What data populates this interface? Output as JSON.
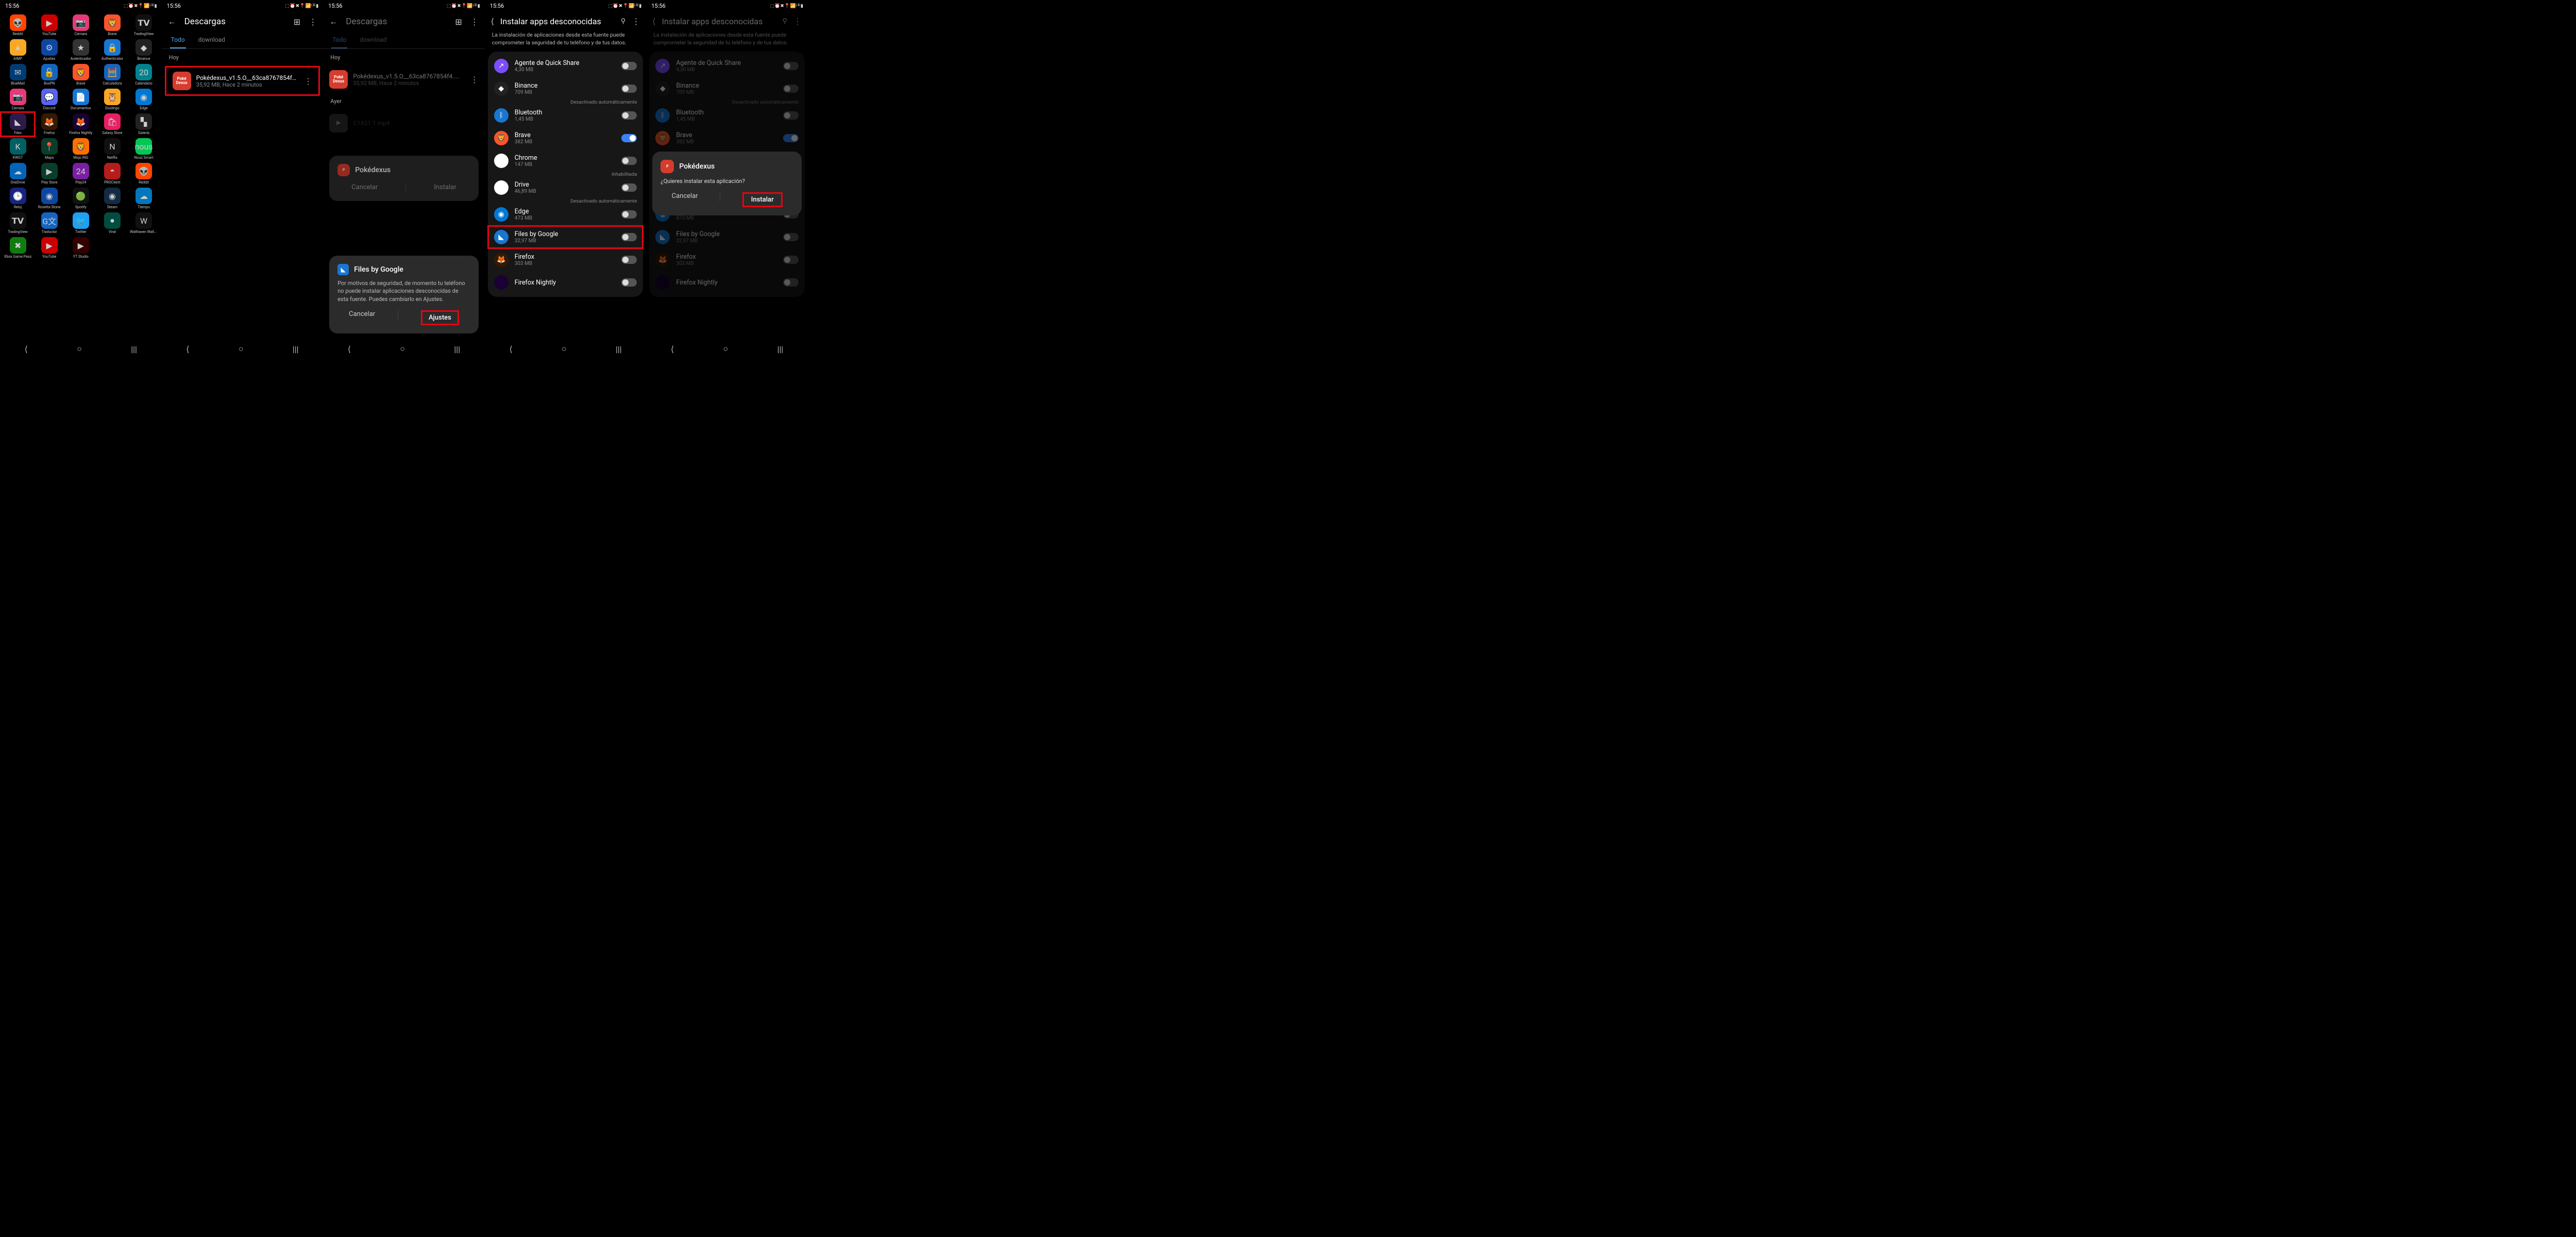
{
  "status": {
    "time": "15:56",
    "icons": "⬚ ⏰ ✖ 📍 📶 ᴸᵀᴱ ▮"
  },
  "nav": {
    "back": "⟨",
    "home": "○",
    "recent": "|||"
  },
  "screen1": {
    "apps": [
      {
        "label": "Reddit",
        "bg": "#ff4500",
        "g": "👽"
      },
      {
        "label": "YouTube",
        "bg": "#cc0000",
        "g": "▶"
      },
      {
        "label": "Cámara",
        "bg": "#e6397a",
        "g": "📷"
      },
      {
        "label": "Brave",
        "bg": "#fb542b",
        "g": "🦁"
      },
      {
        "label": "TradingView",
        "bg": "#111",
        "g": "𝗧𝗩"
      },
      {
        "label": "AIMP",
        "bg": "#f9a825",
        "g": "▲"
      },
      {
        "label": "Ajustes",
        "bg": "#0d47a1",
        "g": "⚙"
      },
      {
        "label": "Autenticador",
        "bg": "#333",
        "g": "★"
      },
      {
        "label": "Authenticator",
        "bg": "#1976d2",
        "g": "🔒"
      },
      {
        "label": "Binance",
        "bg": "#222",
        "g": "◆"
      },
      {
        "label": "BlueMail",
        "bg": "#003b73",
        "g": "✉"
      },
      {
        "label": "BoxPN",
        "bg": "#1565c0",
        "g": "🔓"
      },
      {
        "label": "Brave",
        "bg": "#fb542b",
        "g": "🦁"
      },
      {
        "label": "Calculadora",
        "bg": "#1565c0",
        "g": "🧮"
      },
      {
        "label": "Calendario",
        "bg": "#00838f",
        "g": "20"
      },
      {
        "label": "Cámara",
        "bg": "#e6397a",
        "g": "📷"
      },
      {
        "label": "Discord",
        "bg": "#5865f2",
        "g": "💬"
      },
      {
        "label": "Documentos",
        "bg": "#1976d2",
        "g": "📄"
      },
      {
        "label": "Duolingo",
        "bg": "#f9a825",
        "g": "🦉"
      },
      {
        "label": "Edge",
        "bg": "#0078d4",
        "g": "◉"
      },
      {
        "label": "Files",
        "bg": "#2b1a4a",
        "g": "◣",
        "hl": true
      },
      {
        "label": "Firefox",
        "bg": "#331a00",
        "g": "🦊"
      },
      {
        "label": "Firefox Nightly",
        "bg": "#1a0033",
        "g": "🦊"
      },
      {
        "label": "Galaxy Store",
        "bg": "#e91e63",
        "g": "🛍"
      },
      {
        "label": "Galería",
        "bg": "#222",
        "g": "▚"
      },
      {
        "label": "KWGT",
        "bg": "#006064",
        "g": "K"
      },
      {
        "label": "Maps",
        "bg": "#0a3d2a",
        "g": "📍"
      },
      {
        "label": "Mojo ING",
        "bg": "#ff6f00",
        "g": "🦁"
      },
      {
        "label": "Netflix",
        "bg": "#111",
        "g": "N"
      },
      {
        "label": "Nous Smart",
        "bg": "#00c853",
        "g": "nous"
      },
      {
        "label": "OneDrive",
        "bg": "#0364b8",
        "g": "☁"
      },
      {
        "label": "Play Store",
        "bg": "#0a3d2a",
        "g": "▶"
      },
      {
        "label": "Play24",
        "bg": "#7b1fa2",
        "g": "24"
      },
      {
        "label": "PROClient",
        "bg": "#b71c1c",
        "g": "◓"
      },
      {
        "label": "Reddit",
        "bg": "#ff4500",
        "g": "👽"
      },
      {
        "label": "Reloj",
        "bg": "#1a237e",
        "g": "🕒"
      },
      {
        "label": "Rosetta Stone",
        "bg": "#0d47a1",
        "g": "◉"
      },
      {
        "label": "Spotify",
        "bg": "#111",
        "g": "🟢"
      },
      {
        "label": "Steam",
        "bg": "#132b44",
        "g": "◉"
      },
      {
        "label": "Tiempo",
        "bg": "#0277bd",
        "g": "☁"
      },
      {
        "label": "TradingView",
        "bg": "#111",
        "g": "𝗧𝗩"
      },
      {
        "label": "Traductor",
        "bg": "#1565c0",
        "g": "G文"
      },
      {
        "label": "Twitter",
        "bg": "#1da1f2",
        "g": "🐦"
      },
      {
        "label": "Viral",
        "bg": "#004d40",
        "g": "●"
      },
      {
        "label": "Wallhaven Wallp…",
        "bg": "#111",
        "g": "W"
      },
      {
        "label": "Xbox Game Pass",
        "bg": "#107c10",
        "g": "✖"
      },
      {
        "label": "YouTube",
        "bg": "#cc0000",
        "g": "▶"
      },
      {
        "label": "YT Studio",
        "bg": "#330000",
        "g": "▶"
      }
    ]
  },
  "screen2": {
    "title": "Descargas",
    "tabs": {
      "all": "Todo",
      "download": "download"
    },
    "today": "Hoy",
    "file": {
      "name": "Pokédexus_v1.5.O__63ca8767854f4....",
      "meta": "35,92 MB, Hace 2 minutos"
    }
  },
  "screen3": {
    "title": "Descargas",
    "tabs": {
      "all": "Todo",
      "download": "download"
    },
    "today": "Hoy",
    "yesterday": "Ayer",
    "file": {
      "name": "Pokédexus_v1.5.O__63ca8767854f4....",
      "meta": "35,92 MB, Hace 2 minutos"
    },
    "file2": "C1431 1 mp4",
    "install_popup": {
      "title": "Pokédexus",
      "cancel": "Cancelar",
      "install": "Instalar"
    },
    "security_popup": {
      "title": "Files by Google",
      "body": "Por motivos de seguridad, de momento tu teléfono no puede instalar aplicaciones desconocidas de esta fuente. Puedes cambiarlo en Ajustes.",
      "cancel": "Cancelar",
      "settings": "Ajustes"
    }
  },
  "screen4": {
    "title": "Instalar apps desconocidas",
    "desc": "La instalación de aplicaciones desde esta fuente puede comprometer la seguridad de tu teléfono y de tus datos.",
    "apps": [
      {
        "name": "Agente de Quick Share",
        "size": "4,30 MB",
        "bg": "#7c4dff",
        "g": "↗",
        "on": false,
        "extra": ""
      },
      {
        "name": "Binance",
        "size": "709 MB",
        "bg": "#222",
        "g": "◆",
        "on": false,
        "extra": "Desactivado automáticamente"
      },
      {
        "name": "Bluetooth",
        "size": "1,45 MB",
        "bg": "#1976d2",
        "g": "ᛒ",
        "on": false,
        "extra": ""
      },
      {
        "name": "Brave",
        "size": "382 MB",
        "bg": "#fb542b",
        "g": "🦁",
        "on": true,
        "extra": ""
      },
      {
        "name": "Chrome",
        "size": "147 MB",
        "bg": "#fff",
        "g": "◉",
        "on": false,
        "extra": "Inhabilitada"
      },
      {
        "name": "Drive",
        "size": "46,89 MB",
        "bg": "#fff",
        "g": "▲",
        "on": false,
        "extra": "Desactivado automáticamente"
      },
      {
        "name": "Edge",
        "size": "473 MB",
        "bg": "#0078d4",
        "g": "◉",
        "on": false,
        "extra": ""
      },
      {
        "name": "Files by Google",
        "size": "32,97 MB",
        "bg": "#1976d2",
        "g": "◣",
        "on": false,
        "extra": "",
        "hl": true
      },
      {
        "name": "Firefox",
        "size": "303 MB",
        "bg": "#331a00",
        "g": "🦊",
        "on": false,
        "extra": ""
      },
      {
        "name": "Firefox Nightly",
        "size": "",
        "bg": "#1a0033",
        "g": "",
        "on": false,
        "extra": ""
      }
    ]
  },
  "screen5": {
    "title": "Instalar apps desconocidas",
    "desc": "La instalación de aplicaciones desde esta fuente puede comprometer la seguridad de tu teléfono y de tus datos.",
    "confirm": {
      "title": "Pokédexus",
      "question": "¿Quieres instalar esta aplicación?",
      "cancel": "Cancelar",
      "install": "Instalar"
    }
  }
}
